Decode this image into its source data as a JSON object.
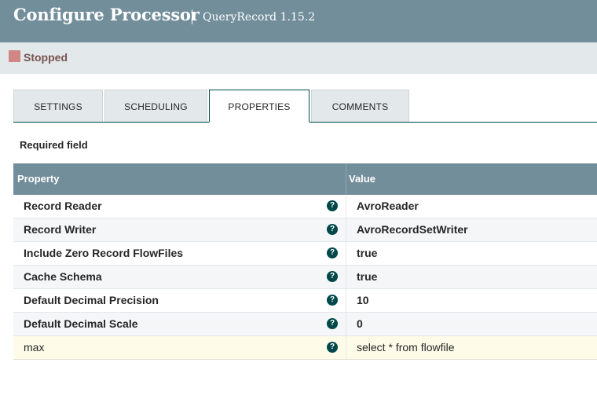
{
  "header": {
    "title": "Configure Processor",
    "subtitle": "QueryRecord 1.15.2"
  },
  "status": {
    "label": "Stopped",
    "color": "#d18686"
  },
  "tabs": [
    {
      "label": "SETTINGS",
      "active": false
    },
    {
      "label": "SCHEDULING",
      "active": false
    },
    {
      "label": "PROPERTIES",
      "active": true
    },
    {
      "label": "COMMENTS",
      "active": false
    }
  ],
  "required_label": "Required field",
  "table": {
    "headers": {
      "property": "Property",
      "value": "Value"
    },
    "rows": [
      {
        "name": "Record Reader",
        "value": "AvroReader",
        "required": true,
        "help_icon": "question-circle-icon"
      },
      {
        "name": "Record Writer",
        "value": "AvroRecordSetWriter",
        "required": true,
        "help_icon": "question-circle-icon"
      },
      {
        "name": "Include Zero Record FlowFiles",
        "value": "true",
        "required": true,
        "help_icon": "question-circle-icon"
      },
      {
        "name": "Cache Schema",
        "value": "true",
        "required": true,
        "help_icon": "question-circle-icon"
      },
      {
        "name": "Default Decimal Precision",
        "value": "10",
        "required": true,
        "help_icon": "question-circle-icon"
      },
      {
        "name": "Default Decimal Scale",
        "value": "0",
        "required": true,
        "help_icon": "question-circle-icon"
      },
      {
        "name": "max",
        "value": "select * from flowfile",
        "required": false,
        "help_icon": "question-circle-icon"
      }
    ]
  }
}
